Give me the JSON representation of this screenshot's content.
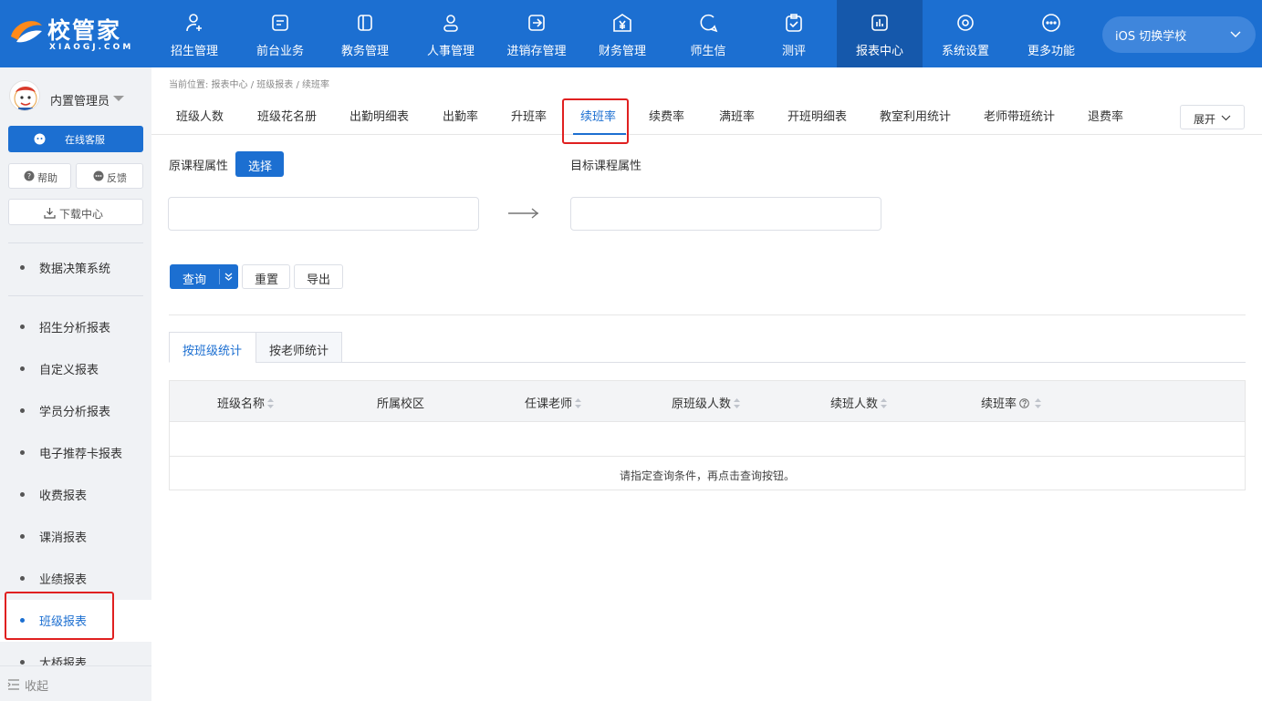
{
  "brand": {
    "name": "校管家",
    "sub": "XIAOGJ.COM"
  },
  "nav": [
    {
      "label": "招生管理",
      "icon": "person-add-icon"
    },
    {
      "label": "前台业务",
      "icon": "front-desk-icon"
    },
    {
      "label": "教务管理",
      "icon": "book-icon"
    },
    {
      "label": "人事管理",
      "icon": "person-icon"
    },
    {
      "label": "进销存管理",
      "icon": "inventory-icon"
    },
    {
      "label": "财务管理",
      "icon": "yen-icon"
    },
    {
      "label": "师生信",
      "icon": "message-icon"
    },
    {
      "label": "测评",
      "icon": "clipboard-check-icon"
    },
    {
      "label": "报表中心",
      "icon": "report-chart-icon",
      "active": true
    },
    {
      "label": "系统设置",
      "icon": "settings-icon"
    },
    {
      "label": "更多功能",
      "icon": "more-icon"
    }
  ],
  "school_switch": {
    "label": "iOS 切换学校"
  },
  "sidebar": {
    "user_name": "内置管理员",
    "service_label": "在线客服",
    "help_label": "帮助",
    "feedback_label": "反馈",
    "download_label": "下载中心",
    "top_item": "数据决策系统",
    "items": [
      {
        "label": "招生分析报表"
      },
      {
        "label": "自定义报表"
      },
      {
        "label": "学员分析报表"
      },
      {
        "label": "电子推荐卡报表"
      },
      {
        "label": "收费报表"
      },
      {
        "label": "课消报表"
      },
      {
        "label": "业绩报表"
      },
      {
        "label": "班级报表",
        "active": true
      },
      {
        "label": "大桥报表"
      }
    ],
    "collapse_label": "收起"
  },
  "breadcrumb": "当前位置: 报表中心 / 班级报表 / 续班率",
  "tabs": [
    {
      "label": "班级人数"
    },
    {
      "label": "班级花名册"
    },
    {
      "label": "出勤明细表"
    },
    {
      "label": "出勤率"
    },
    {
      "label": "升班率"
    },
    {
      "label": "续班率",
      "active": true
    },
    {
      "label": "续费率"
    },
    {
      "label": "满班率"
    },
    {
      "label": "开班明细表"
    },
    {
      "label": "教室利用统计"
    },
    {
      "label": "老师带班统计"
    },
    {
      "label": "退费率"
    }
  ],
  "expand_label": "展开",
  "filters": {
    "orig_label": "原课程属性",
    "choose_label": "选择",
    "target_label": "目标课程属性",
    "orig_value": "",
    "target_value": ""
  },
  "actions": {
    "query": "查询",
    "reset": "重置",
    "export": "导出"
  },
  "subtabs": [
    {
      "label": "按班级统计",
      "active": true
    },
    {
      "label": "按老师统计"
    }
  ],
  "table": {
    "columns": [
      "班级名称",
      "所属校区",
      "任课老师",
      "原班级人数",
      "续班人数",
      "续班率"
    ],
    "empty_message": "请指定查询条件，再点击查询按钮。"
  },
  "colors": {
    "primary": "#1c6fd1",
    "highlight": "#e02020"
  }
}
